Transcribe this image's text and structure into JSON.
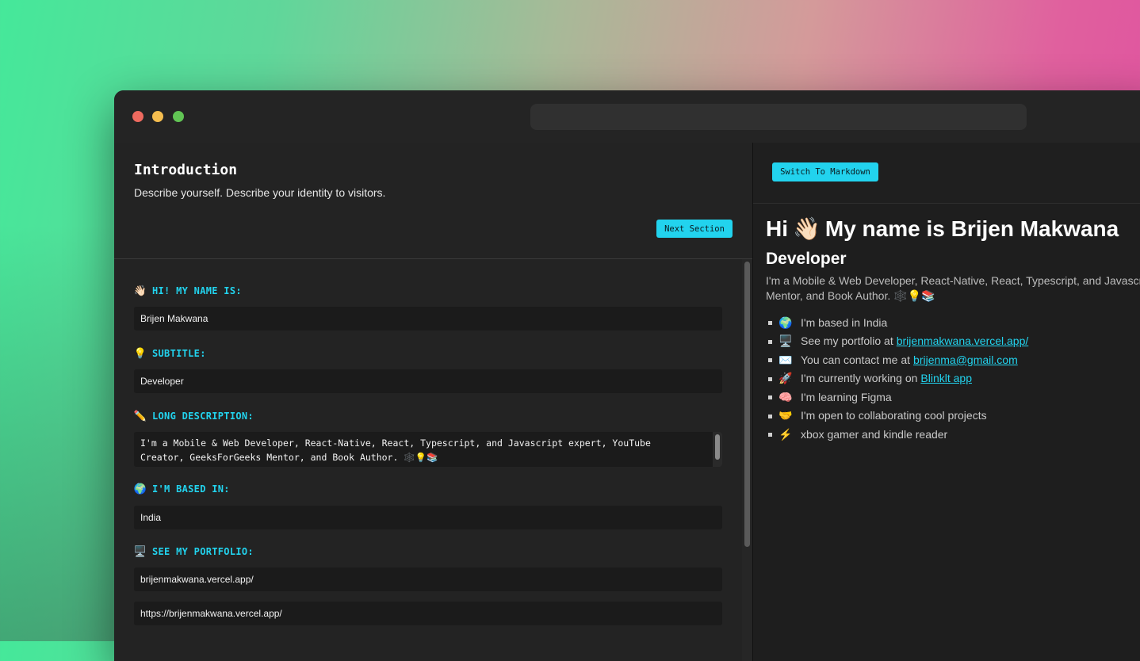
{
  "window": {
    "url": ""
  },
  "editor": {
    "section_title": "Introduction",
    "section_description": "Describe yourself. Describe your identity to visitors.",
    "next_button": "Next Section",
    "fields": {
      "name": {
        "label": "HI! MY NAME IS:",
        "icon": "waving-hand-icon",
        "value": "Brijen Makwana"
      },
      "subtitle": {
        "label": "SUBTITLE:",
        "icon": "light-bulb-icon",
        "value": "Developer"
      },
      "long_description": {
        "label": "LONG DESCRIPTION:",
        "icon": "pencil-icon",
        "value": "I'm a Mobile & Web Developer, React-Native, React, Typescript, and Javascript expert, YouTube Creator, GeeksForGeeks Mentor, and Book Author. 🕸️💡📚"
      },
      "based_in": {
        "label": "I'M BASED IN:",
        "icon": "globe-icon",
        "value": "India"
      },
      "portfolio": {
        "label": "SEE MY PORTFOLIO:",
        "icon": "desktop-computer-icon",
        "value": "brijenmakwana.vercel.app/",
        "url": "https://brijenmakwana.vercel.app/"
      }
    }
  },
  "preview": {
    "switch_button": "Switch To Markdown",
    "heading_pre": "Hi",
    "heading_post": "My name is Brijen Makwana",
    "subtitle": "Developer",
    "description_line1": "I'm a Mobile & Web Developer, React-Native, React, Typescript, and Javascrip",
    "description_line2": "Mentor, and Book Author. 🕸️💡📚",
    "items": [
      {
        "icon": "globe-icon",
        "emoji": "🌍",
        "text": "I'm based in India",
        "link": ""
      },
      {
        "icon": "desktop-computer-icon",
        "emoji": "🖥️",
        "text": "See my portfolio at",
        "link": "brijenmakwana.vercel.app/"
      },
      {
        "icon": "envelope-icon",
        "emoji": "✉️",
        "text": "You can contact me at",
        "link": "brijenma@gmail.com"
      },
      {
        "icon": "rocket-icon",
        "emoji": "🚀",
        "text": "I'm currently working on",
        "link": "Blinklt app"
      },
      {
        "icon": "brain-icon",
        "emoji": "🧠",
        "text": "I'm learning Figma",
        "link": ""
      },
      {
        "icon": "handshake-icon",
        "emoji": "🤝",
        "text": "I'm open to collaborating cool projects",
        "link": ""
      },
      {
        "icon": "lightning-icon",
        "emoji": "⚡",
        "text": "xbox gamer and kindle reader",
        "link": ""
      }
    ]
  }
}
